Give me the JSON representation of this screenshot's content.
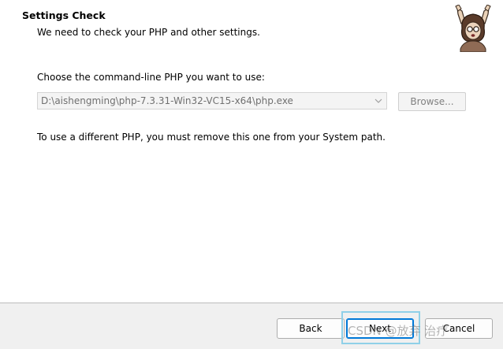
{
  "header": {
    "title": "Settings Check",
    "subtitle": "We need to check your PHP and other settings."
  },
  "main": {
    "prompt": "Choose the command-line PHP you want to use:",
    "php_path": "D:\\aishengming\\php-7.3.31-Win32-VC15-x64\\php.exe",
    "browse_label": "Browse...",
    "note": "To use a different PHP, you must remove this one from your System path."
  },
  "footer": {
    "back_label": "Back",
    "next_label": "Next",
    "cancel_label": "Cancel"
  },
  "watermark": "CSDN @放弃    治疗",
  "colors": {
    "accent": "#0078d7",
    "focus_ring": "#8fd0e8",
    "footer_bg": "#f0f0f0"
  },
  "icons": [
    "composer-logo-icon",
    "chevron-down-icon"
  ]
}
